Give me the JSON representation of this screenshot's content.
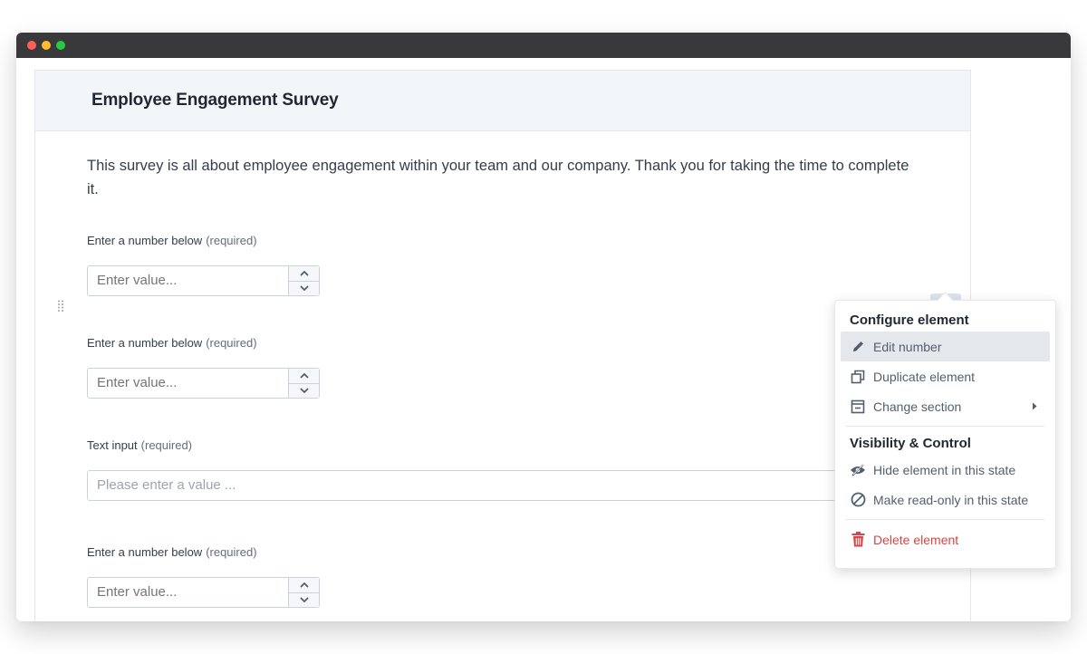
{
  "window": {
    "traffic_lights": [
      "close",
      "minimize",
      "maximize"
    ],
    "colors": {
      "close": "#fe5f57",
      "minimize": "#febc2e",
      "maximize": "#28c840"
    }
  },
  "survey": {
    "title": "Employee Engagement Survey",
    "intro": "This survey is all about employee engagement within your team and our company. Thank you for taking the time to complete it.",
    "fields": [
      {
        "type": "number",
        "label": "Enter a number below",
        "required": "(required)",
        "placeholder": "Enter value..."
      },
      {
        "type": "number",
        "label": "Enter a number below",
        "required": "(required)",
        "placeholder": "Enter value..."
      },
      {
        "type": "text",
        "label": "Text input",
        "required": "(required)",
        "placeholder": "Please enter a value ..."
      },
      {
        "type": "number",
        "label": "Enter a number below",
        "required": "(required)",
        "placeholder": "Enter value..."
      }
    ]
  },
  "icons": {
    "drag": "drag-handle-icon",
    "more": "more-horizontal-icon",
    "increment": "chevron-up-icon",
    "decrement": "chevron-down-icon"
  },
  "context_menu": {
    "section1_heading": "Configure element",
    "edit": "Edit number",
    "duplicate": "Duplicate element",
    "change_section": "Change section",
    "section2_heading": "Visibility & Control",
    "hide": "Hide element in this state",
    "readonly": "Make read-only in this state",
    "delete": "Delete element",
    "colors": {
      "danger": "#d64545",
      "icon": "#52606d",
      "active_bg": "#e4e8ed"
    }
  }
}
